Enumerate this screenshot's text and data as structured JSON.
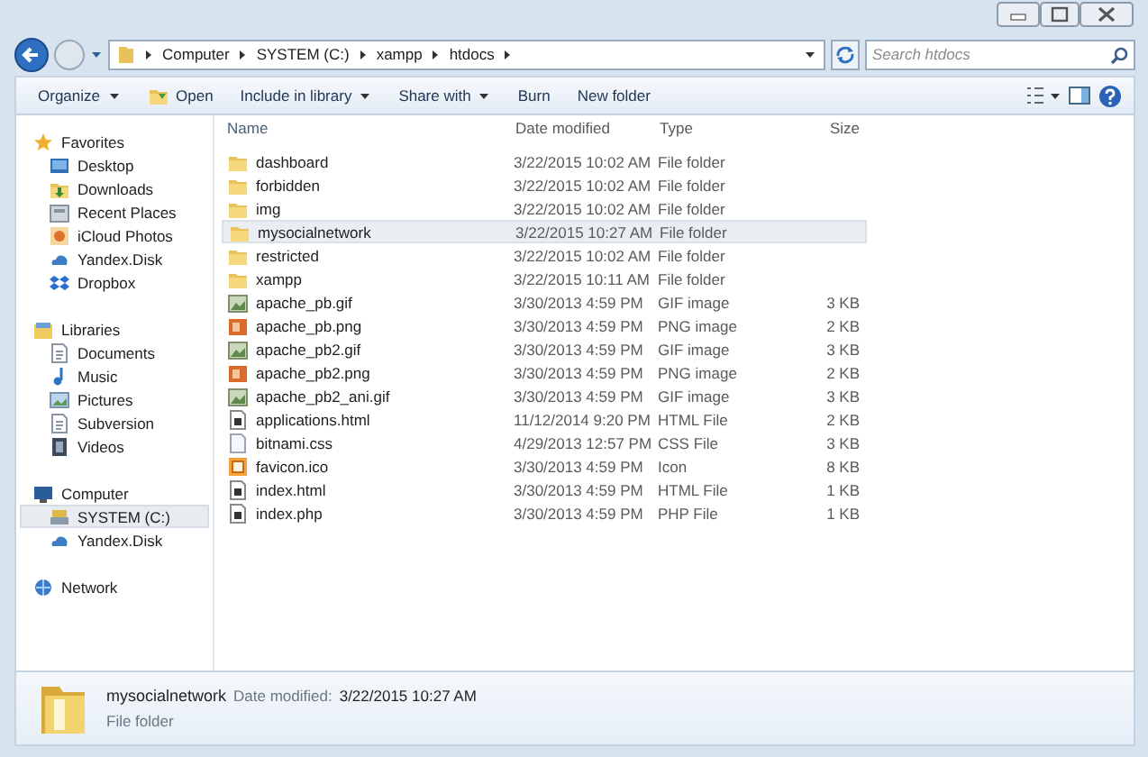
{
  "address": {
    "path": [
      "Computer",
      "SYSTEM (C:)",
      "xampp",
      "htdocs"
    ]
  },
  "search": {
    "placeholder": "Search htdocs"
  },
  "toolbar": [
    {
      "label": "Organize",
      "dropdown": true,
      "icon": false
    },
    {
      "label": "Open",
      "dropdown": false,
      "icon": true
    },
    {
      "label": "Include in library",
      "dropdown": true,
      "icon": false
    },
    {
      "label": "Share with",
      "dropdown": true,
      "icon": false
    },
    {
      "label": "Burn",
      "dropdown": false,
      "icon": false
    },
    {
      "label": "New folder",
      "dropdown": false,
      "icon": false
    }
  ],
  "nav": [
    {
      "label": "Favorites",
      "kind": "star",
      "selected": false,
      "children": [
        {
          "label": "Desktop",
          "kind": "desktop",
          "selected": false
        },
        {
          "label": "Downloads",
          "kind": "download",
          "selected": false
        },
        {
          "label": "Recent Places",
          "kind": "recent",
          "selected": false
        },
        {
          "label": "iCloud Photos",
          "kind": "photos",
          "selected": false
        },
        {
          "label": "Yandex.Disk",
          "kind": "cloud",
          "selected": false
        },
        {
          "label": "Dropbox",
          "kind": "box",
          "selected": false
        }
      ]
    },
    {
      "label": "Libraries",
      "kind": "library",
      "selected": false,
      "children": [
        {
          "label": "Documents",
          "kind": "document",
          "selected": false
        },
        {
          "label": "Music",
          "kind": "music",
          "selected": false
        },
        {
          "label": "Pictures",
          "kind": "pictures",
          "selected": false
        },
        {
          "label": "Subversion",
          "kind": "document",
          "selected": false
        },
        {
          "label": "Videos",
          "kind": "video",
          "selected": false
        }
      ]
    },
    {
      "label": "Computer",
      "kind": "computer",
      "selected": false,
      "children": [
        {
          "label": "SYSTEM (C:)",
          "kind": "drive",
          "selected": true
        },
        {
          "label": "Yandex.Disk",
          "kind": "cloud",
          "selected": false
        }
      ]
    },
    {
      "label": "Network",
      "kind": "network",
      "selected": false
    }
  ],
  "columns": [
    "Name",
    "Date modified",
    "Type",
    "Size"
  ],
  "files": [
    {
      "name": "dashboard",
      "date": "3/22/2015 10:02 AM",
      "type": "File folder",
      "kind": "folder",
      "selected": false
    },
    {
      "name": "forbidden",
      "date": "3/22/2015 10:02 AM",
      "type": "File folder",
      "kind": "folder",
      "selected": false
    },
    {
      "name": "img",
      "date": "3/22/2015 10:02 AM",
      "type": "File folder",
      "kind": "folder",
      "selected": false
    },
    {
      "name": "mysocialnetwork",
      "date": "3/22/2015 10:27 AM",
      "type": "File folder",
      "kind": "folder",
      "selected": true
    },
    {
      "name": "restricted",
      "date": "3/22/2015 10:02 AM",
      "type": "File folder",
      "kind": "folder",
      "selected": false
    },
    {
      "name": "xampp",
      "date": "3/22/2015 10:11 AM",
      "type": "File folder",
      "kind": "folder",
      "selected": false
    },
    {
      "name": "apache_pb.gif",
      "date": "3/30/2013 4:59 PM",
      "type": "GIF image",
      "size": "3 KB",
      "kind": "gif",
      "selected": false
    },
    {
      "name": "apache_pb.png",
      "date": "3/30/2013 4:59 PM",
      "type": "PNG image",
      "size": "2 KB",
      "kind": "png",
      "selected": false
    },
    {
      "name": "apache_pb2.gif",
      "date": "3/30/2013 4:59 PM",
      "type": "GIF image",
      "size": "3 KB",
      "kind": "gif",
      "selected": false
    },
    {
      "name": "apache_pb2.png",
      "date": "3/30/2013 4:59 PM",
      "type": "PNG image",
      "size": "2 KB",
      "kind": "png",
      "selected": false
    },
    {
      "name": "apache_pb2_ani.gif",
      "date": "3/30/2013 4:59 PM",
      "type": "GIF image",
      "size": "3 KB",
      "kind": "gif",
      "selected": false
    },
    {
      "name": "applications.html",
      "date": "11/12/2014 9:20 PM",
      "type": "HTML File",
      "size": "2 KB",
      "kind": "html",
      "selected": false
    },
    {
      "name": "bitnami.css",
      "date": "4/29/2013 12:57 PM",
      "type": "CSS File",
      "size": "3 KB",
      "kind": "css",
      "selected": false
    },
    {
      "name": "favicon.ico",
      "date": "3/30/2013 4:59 PM",
      "type": "Icon",
      "size": "8 KB",
      "kind": "ico",
      "selected": false
    },
    {
      "name": "index.html",
      "date": "3/30/2013 4:59 PM",
      "type": "HTML File",
      "size": "1 KB",
      "kind": "html",
      "selected": false
    },
    {
      "name": "index.php",
      "date": "3/30/2013 4:59 PM",
      "type": "PHP File",
      "size": "1 KB",
      "kind": "html",
      "selected": false
    }
  ],
  "details": {
    "name": "mysocialnetwork",
    "date_label": "Date modified:",
    "date": "3/22/2015 10:27 AM",
    "type": "File folder"
  }
}
